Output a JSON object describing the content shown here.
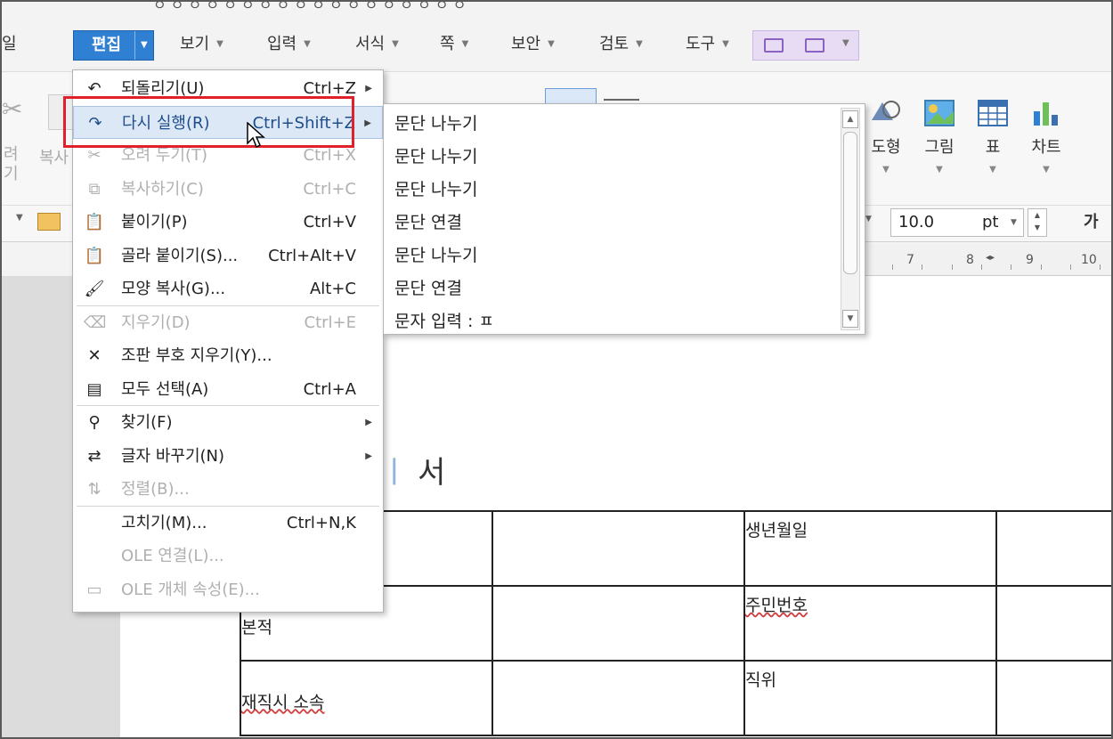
{
  "menubar": {
    "left_partial": "일",
    "active": "편집",
    "items": [
      "보기",
      "입력",
      "서식",
      "쪽",
      "보안",
      "검토",
      "도구"
    ]
  },
  "ribbon": {
    "left_partial": [
      "려",
      "기",
      "복사"
    ],
    "buttons": [
      {
        "label": "도형",
        "icon": "shape-icon"
      },
      {
        "label": "그림",
        "icon": "picture-icon"
      },
      {
        "label": "표",
        "icon": "table-icon"
      },
      {
        "label": "차트",
        "icon": "chart-icon"
      }
    ]
  },
  "format_bar": {
    "font_size": "10.0",
    "unit": "pt",
    "bold_glyph": "가"
  },
  "ruler": {
    "ticks": [
      "7",
      "8",
      "9",
      "10"
    ]
  },
  "edit_menu": {
    "items": [
      {
        "label": "되돌리기(U)",
        "shortcut": "Ctrl+Z",
        "sub": true,
        "state": "normal",
        "icon": "undo-icon"
      },
      {
        "label": "다시 실행(R)",
        "shortcut": "Ctrl+Shift+Z",
        "sub": true,
        "state": "highlighted",
        "icon": "redo-icon"
      },
      {
        "label": "오려 두기(T)",
        "shortcut": "Ctrl+X",
        "sub": false,
        "state": "disabled",
        "icon": "scissors-icon"
      },
      {
        "label": "복사하기(C)",
        "shortcut": "Ctrl+C",
        "sub": false,
        "state": "disabled",
        "icon": "copy-icon"
      },
      {
        "label": "붙이기(P)",
        "shortcut": "Ctrl+V",
        "sub": false,
        "state": "normal",
        "icon": "paste-icon"
      },
      {
        "label": "골라 붙이기(S)...",
        "shortcut": "Ctrl+Alt+V",
        "sub": false,
        "state": "normal",
        "icon": "paste-special-icon"
      },
      {
        "label": "모양 복사(G)...",
        "shortcut": "Alt+C",
        "sub": false,
        "state": "normal",
        "icon": "format-painter-icon"
      },
      {
        "label": "지우기(D)",
        "shortcut": "Ctrl+E",
        "sub": false,
        "state": "disabled",
        "icon": "erase-icon"
      },
      {
        "label": "조판 부호 지우기(Y)...",
        "shortcut": "",
        "sub": false,
        "state": "normal",
        "icon": "clear-codes-icon"
      },
      {
        "label": "모두 선택(A)",
        "shortcut": "Ctrl+A",
        "sub": false,
        "state": "normal",
        "icon": "select-all-icon"
      },
      {
        "label": "찾기(F)",
        "shortcut": "",
        "sub": true,
        "state": "normal",
        "icon": "binoculars-icon"
      },
      {
        "label": "글자 바꾸기(N)",
        "shortcut": "",
        "sub": true,
        "state": "normal",
        "icon": "replace-icon"
      },
      {
        "label": "정렬(B)...",
        "shortcut": "",
        "sub": false,
        "state": "disabled",
        "icon": "sort-icon"
      },
      {
        "label": "고치기(M)...",
        "shortcut": "Ctrl+N,K",
        "sub": false,
        "state": "normal",
        "icon": ""
      },
      {
        "label": "OLE 연결(L)...",
        "shortcut": "",
        "sub": false,
        "state": "disabled",
        "icon": ""
      },
      {
        "label": "OLE 개체 속성(E)...",
        "shortcut": "",
        "sub": false,
        "state": "disabled",
        "icon": "ole-icon"
      }
    ]
  },
  "redo_submenu": {
    "items": [
      "문단 나누기",
      "문단 나누기",
      "문단 나누기",
      "문단 연결",
      "문단 나누기",
      "문단 연결",
      "문자 입력 : ㅍ"
    ]
  },
  "document": {
    "title_partial": "서",
    "title_blue_partial": "ㅣ",
    "table": [
      [
        "",
        "",
        "생년월일",
        ""
      ],
      [
        "본적",
        "",
        "주민번호",
        ""
      ],
      [
        "재직시  소속",
        "",
        "직위",
        ""
      ]
    ]
  }
}
